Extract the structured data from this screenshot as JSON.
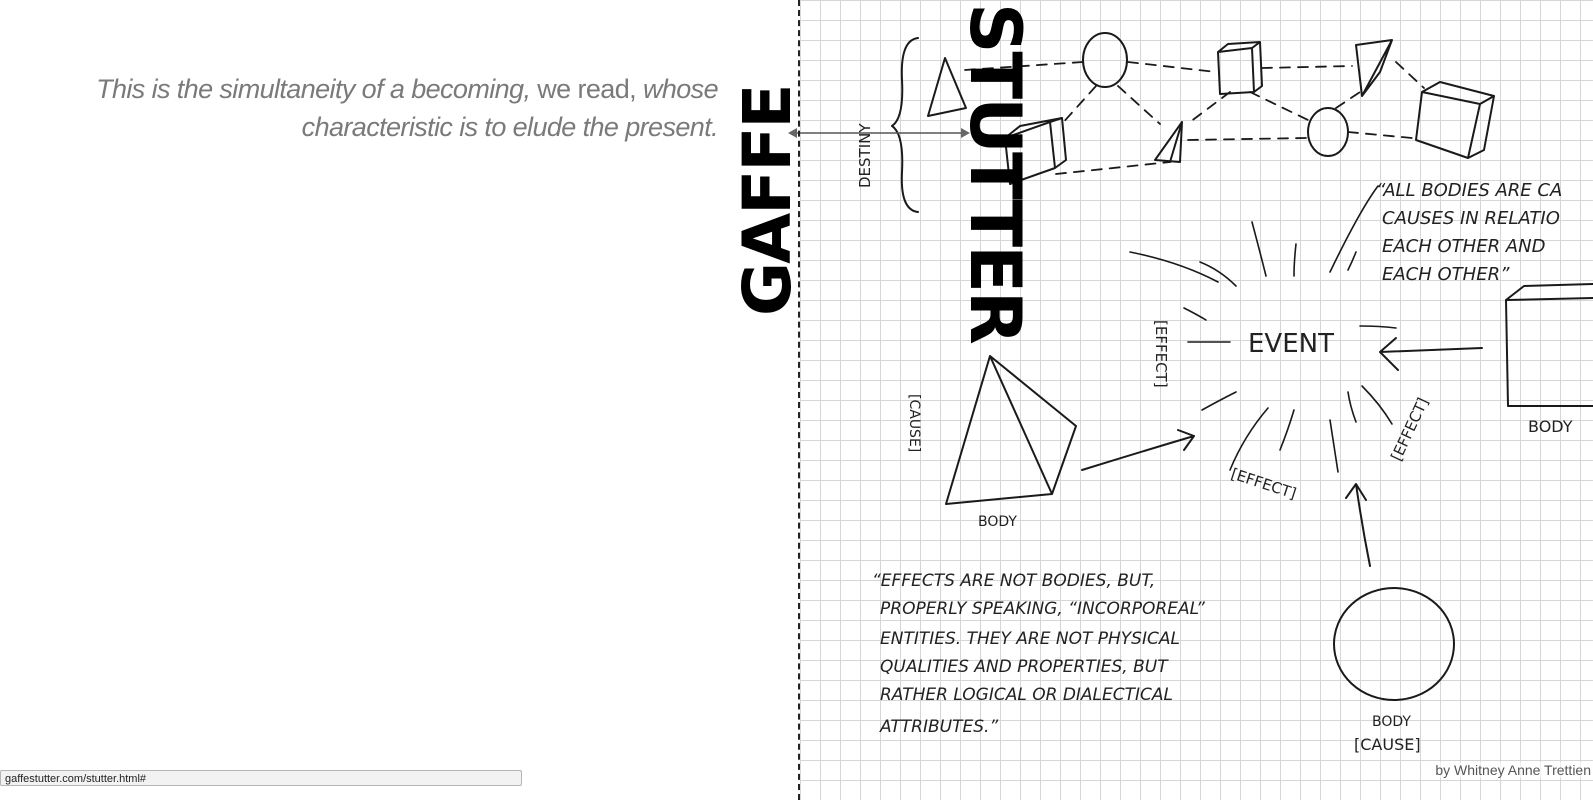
{
  "quote": {
    "part1": "This is the simultaneity of a becoming,",
    "part2": " we read, ",
    "part3": "whose characteristic is to elude the present."
  },
  "titles": {
    "left": "GAFFE",
    "right": "STUTTER"
  },
  "sketch": {
    "destiny": "DESTINY",
    "event": "EVENT",
    "effect_1": "[EFFECT]",
    "effect_2": "[EFFECT]",
    "effect_3": "[EFFECT]",
    "cause_left": "[CAUSE]",
    "body_left": "BODY",
    "body_right": "BODY",
    "body_bottom": "BODY",
    "cause_bottom": "[CAUSE]",
    "quote_top_lines": [
      "“ALL BODIES ARE CA",
      "CAUSES IN RELATIO",
      "EACH OTHER AND",
      "EACH OTHER”"
    ],
    "quote_bottom_lines": [
      "“EFFECTS ARE NOT BODIES, BUT,",
      "PROPERLY SPEAKING, “INCORPOREAL”",
      "ENTITIES. THEY ARE NOT PHYSICAL",
      "QUALITIES AND PROPERTIES, BUT",
      "RATHER LOGICAL OR DIALECTICAL",
      "ATTRIBUTES.”"
    ]
  },
  "credit": "by Whitney Anne Trettien",
  "status_url": "gaffestutter.com/stutter.html#"
}
